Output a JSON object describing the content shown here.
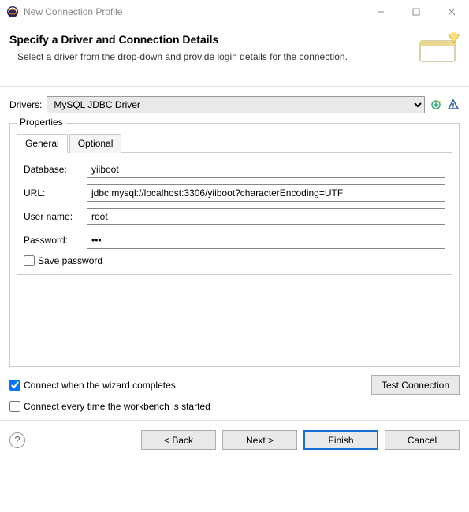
{
  "window": {
    "title": "New Connection Profile"
  },
  "header": {
    "title": "Specify a Driver and Connection Details",
    "subtitle": "Select a driver from the drop-down and provide login details for the connection."
  },
  "drivers": {
    "label": "Drivers:",
    "selected": "MySQL JDBC Driver"
  },
  "properties": {
    "legend": "Properties",
    "tabs": {
      "general": "General",
      "optional": "Optional"
    },
    "fields": {
      "database_label": "Database:",
      "database_value": "yiiboot",
      "url_label": "URL:",
      "url_value": "jdbc:mysql://localhost:3306/yiiboot?characterEncoding=UTF",
      "username_label": "User name:",
      "username_value": "root",
      "password_label": "Password:",
      "password_value": "•••",
      "save_password_label": "Save password"
    }
  },
  "options": {
    "connect_on_finish": "Connect when the wizard completes",
    "connect_on_startup": "Connect every time the workbench is started",
    "test_connection": "Test Connection"
  },
  "buttons": {
    "back": "< Back",
    "next": "Next >",
    "finish": "Finish",
    "cancel": "Cancel"
  }
}
